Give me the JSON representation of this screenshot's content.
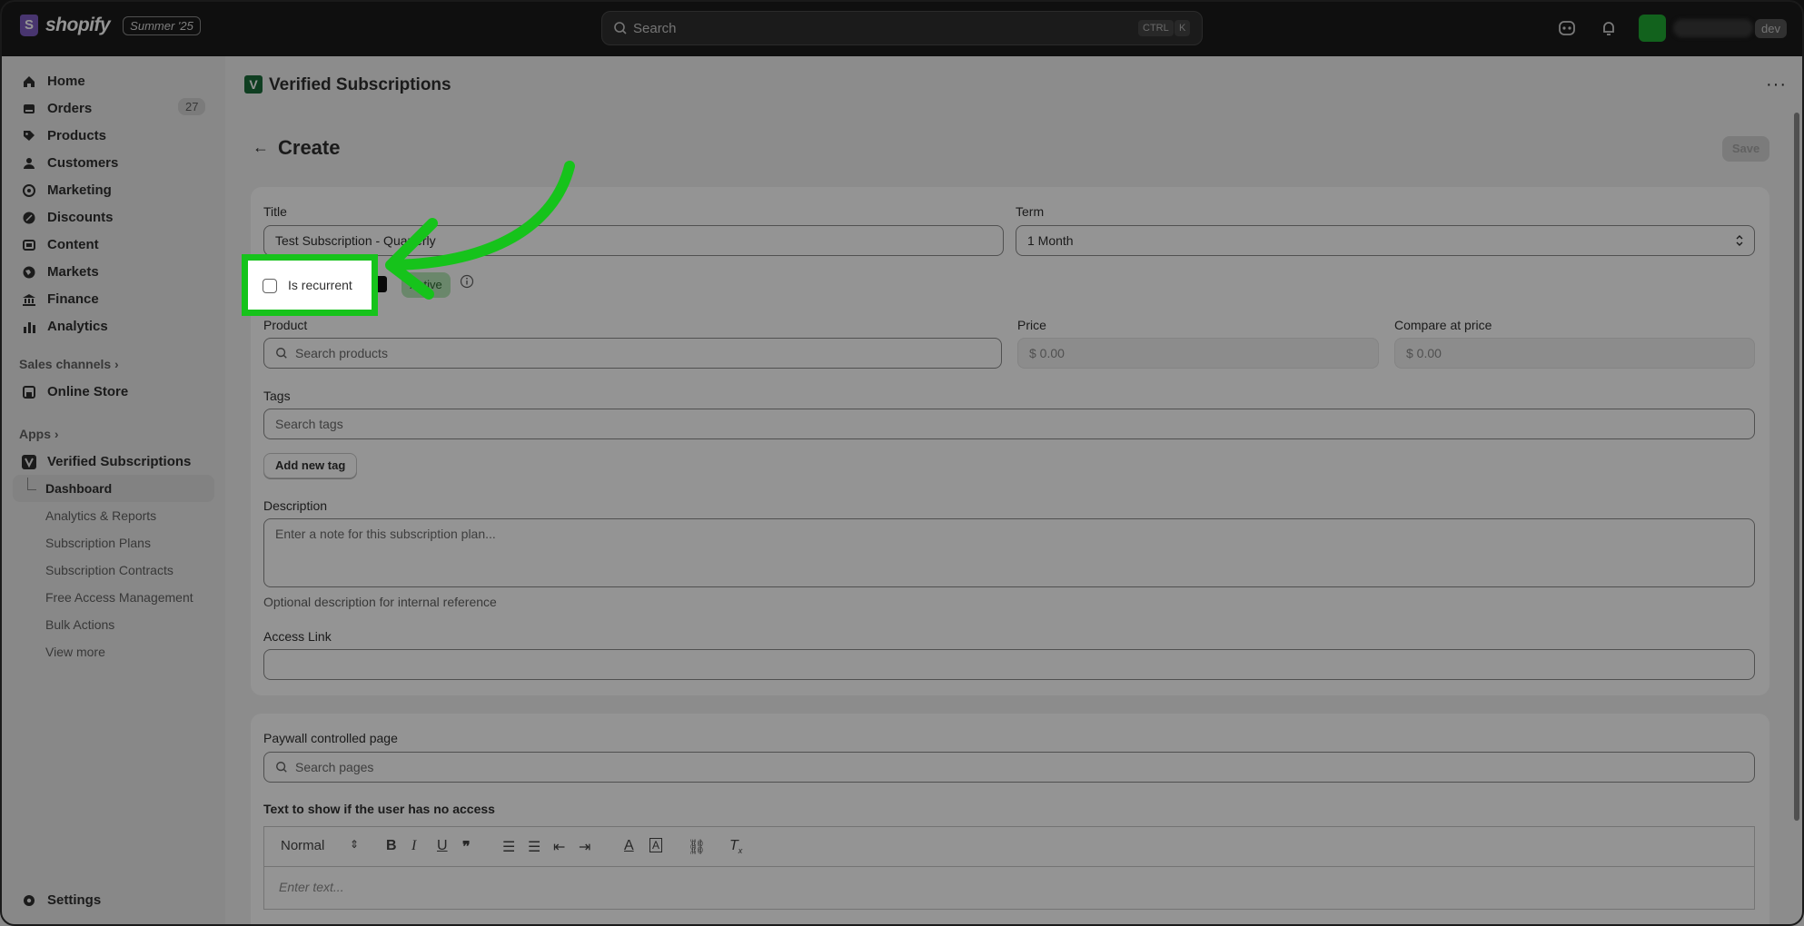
{
  "topbar": {
    "brand": "shopify",
    "brand_mark": "S",
    "edition_badge": "Summer '25",
    "search_placeholder": "Search",
    "kbd_ctrl": "CTRL",
    "kbd_k": "K",
    "store_badge": "dev"
  },
  "sidebar": {
    "items": [
      {
        "label": "Home",
        "icon": "home-icon"
      },
      {
        "label": "Orders",
        "icon": "orders-icon",
        "badge": "27"
      },
      {
        "label": "Products",
        "icon": "tag-icon"
      },
      {
        "label": "Customers",
        "icon": "person-icon"
      },
      {
        "label": "Marketing",
        "icon": "target-icon"
      },
      {
        "label": "Discounts",
        "icon": "discount-icon"
      },
      {
        "label": "Content",
        "icon": "content-icon"
      },
      {
        "label": "Markets",
        "icon": "globe-icon"
      },
      {
        "label": "Finance",
        "icon": "bank-icon"
      },
      {
        "label": "Analytics",
        "icon": "bar-chart-icon"
      }
    ],
    "sales_channels_label": "Sales channels",
    "online_store": "Online Store",
    "apps_label": "Apps",
    "app_name": "Verified Subscriptions",
    "app_sub_items": [
      "Dashboard",
      "Analytics & Reports",
      "Subscription Plans",
      "Subscription Contracts",
      "Free Access Management",
      "Bulk Actions",
      "View more"
    ],
    "settings": "Settings"
  },
  "header": {
    "app_title": "Verified Subscriptions",
    "app_icon_letter": "V",
    "more": "···",
    "page_title": "Create",
    "save_label": "Save"
  },
  "form": {
    "title_label": "Title",
    "title_value": "Test Subscription - Quarterly",
    "term_label": "Term",
    "term_value": "1 Month",
    "is_recurrent_label": "Is recurrent",
    "is_recurrent_checked": false,
    "active_badge": "Active",
    "product_label": "Product",
    "product_placeholder": "Search products",
    "price_label": "Price",
    "price_value": "$ 0.00",
    "compare_label": "Compare at price",
    "compare_value": "$ 0.00",
    "tags_label": "Tags",
    "tags_placeholder": "Search tags",
    "add_tag_label": "Add new tag",
    "description_label": "Description",
    "description_placeholder": "Enter a note for this subscription plan...",
    "description_help": "Optional description for internal reference",
    "access_link_label": "Access Link",
    "access_link_value": ""
  },
  "paywall": {
    "page_label": "Paywall controlled page",
    "page_placeholder": "Search pages",
    "no_access_label": "Text to show if the user has no access",
    "format_value": "Normal",
    "editor_placeholder": "Enter text..."
  },
  "colors": {
    "highlight": "#16c31b",
    "brand_purple": "#7c5cbf",
    "app_green": "#1a6b3a"
  }
}
